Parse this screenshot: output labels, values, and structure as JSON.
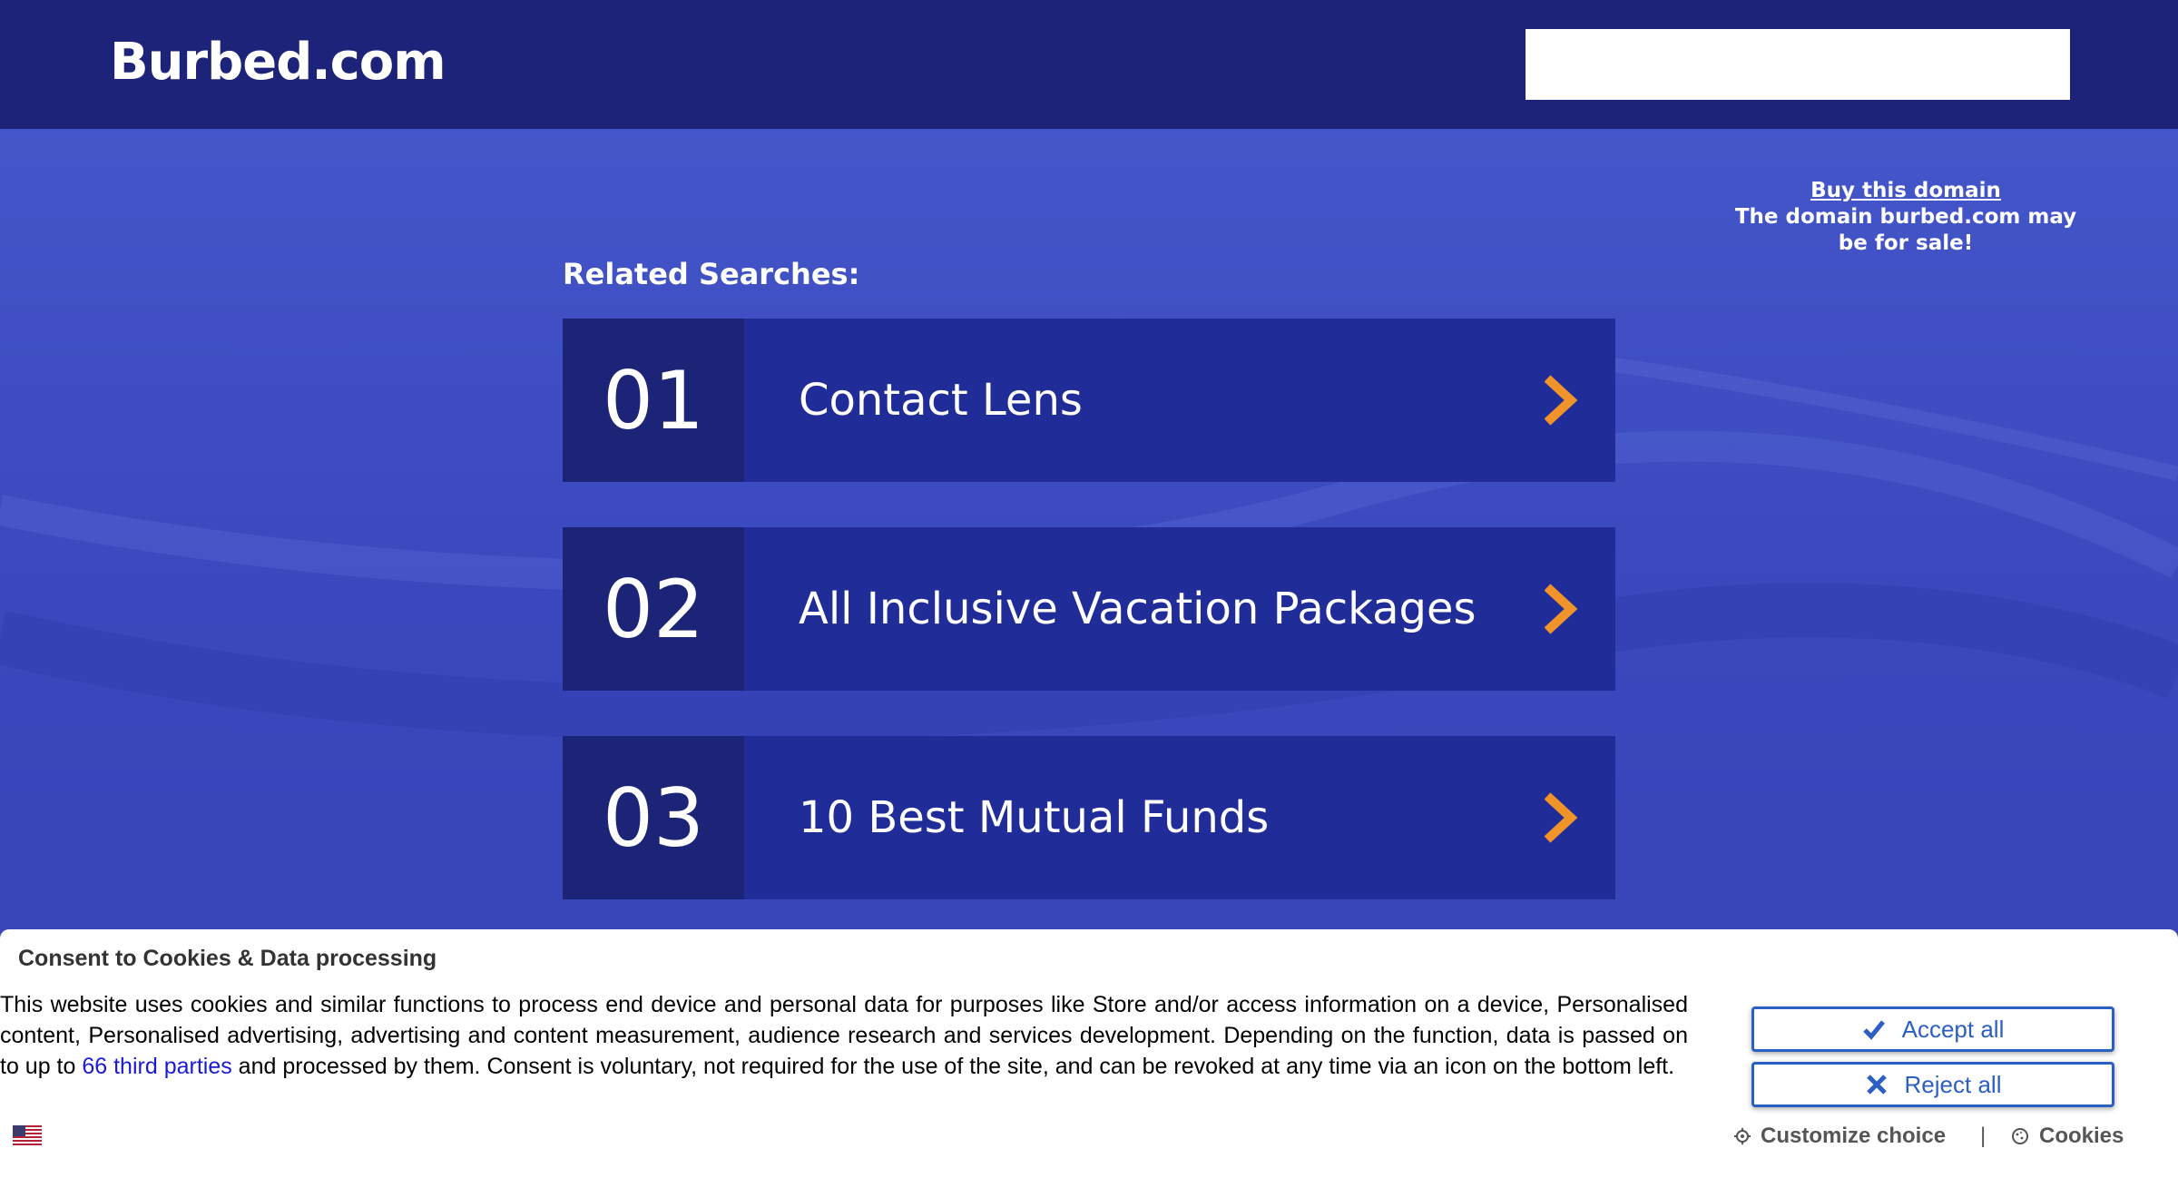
{
  "header": {
    "logo": "Burbed.com",
    "search_placeholder": ""
  },
  "buy_domain": {
    "link": "Buy this domain",
    "line1": "The domain burbed.com may",
    "line2": "be for sale!"
  },
  "related": {
    "title": "Related Searches:",
    "items": [
      {
        "num": "01",
        "label": "Contact Lens"
      },
      {
        "num": "02",
        "label": "All Inclusive Vacation Packages"
      },
      {
        "num": "03",
        "label": "10 Best Mutual Funds"
      }
    ]
  },
  "consent": {
    "title": "Consent to Cookies & Data processing",
    "text_before": "This website uses cookies and similar functions to process end device and personal data for purposes like Store and/or access information on a device, Personalised content, Personalised advertising, advertising and content measurement, audience research and services development. Depending on the function, data is passed on to up to ",
    "link": "66 third parties",
    "text_after": " and processed by them. Consent is voluntary, not required for the use of the site, and can be revoked at any time via an icon on the bottom left.",
    "accept": "Accept all",
    "reject": "Reject all",
    "customize": "Customize choice",
    "separator": "|",
    "cookies": "Cookies"
  },
  "colors": {
    "header_bg": "#1c2379",
    "main_bg": "#3f4fc3",
    "card_bg": "#202d99",
    "num_bg": "#1b2477",
    "arrow": "#f0942a",
    "button_blue": "#2b5fc4"
  },
  "icons": {
    "result_arrow": "chevron-right-icon",
    "accept": "checkmark-icon",
    "reject": "x-icon",
    "customize": "gear-icon",
    "cookies": "cookie-icon",
    "language": "us-flag-icon"
  }
}
